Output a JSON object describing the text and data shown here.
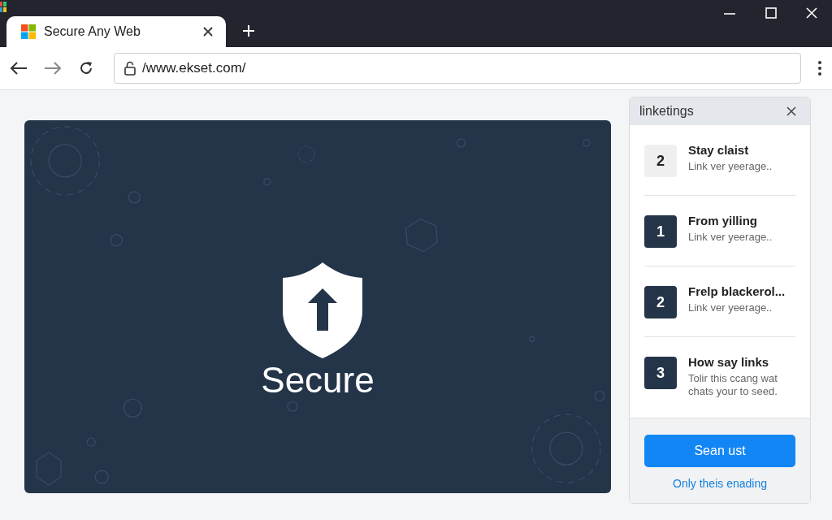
{
  "tab": {
    "title": "Secure Any Web",
    "selected": true
  },
  "address_bar": {
    "url": "/www.ekset.com/"
  },
  "hero": {
    "title": "Secure"
  },
  "panel": {
    "title": "linketings",
    "items": [
      {
        "number": "2",
        "title": "Stay claist",
        "text": "Link ver yeerage..",
        "filled": false
      },
      {
        "number": "1",
        "title": "From yilling",
        "text": "Link ver yeerage..",
        "filled": true
      },
      {
        "number": "2",
        "title": "Frelp blackerol...",
        "text": "Link ver yeerage..",
        "filled": true
      },
      {
        "number": "3",
        "title": "How say links",
        "text": "Tolir this ccang wat chats your to seed.",
        "filled": true
      }
    ],
    "button": "Sean ust",
    "link": "Only theis enading"
  }
}
